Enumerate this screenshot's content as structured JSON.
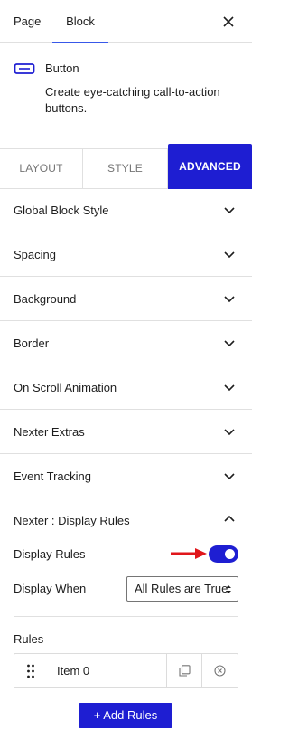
{
  "top_tabs": {
    "page": "Page",
    "block": "Block"
  },
  "block_card": {
    "name": "Button",
    "description": "Create eye-catching call-to-action buttons.",
    "icon": "button-icon"
  },
  "style_tabs": {
    "layout": "LAYOUT",
    "style": "STYLE",
    "advanced": "ADVANCED",
    "active": "ADVANCED"
  },
  "panels": [
    {
      "label": "Global Block Style"
    },
    {
      "label": "Spacing"
    },
    {
      "label": "Background"
    },
    {
      "label": "Border"
    },
    {
      "label": "On Scroll Animation"
    },
    {
      "label": "Nexter Extras"
    },
    {
      "label": "Event Tracking"
    }
  ],
  "display_rules_section": {
    "title": "Nexter : Display Rules",
    "display_rules_label": "Display Rules",
    "display_rules_enabled": true,
    "display_when_label": "Display When",
    "display_when_value": "All Rules are True",
    "rules_label": "Rules",
    "rules": [
      {
        "title": "Item 0"
      }
    ],
    "add_button": "+ Add Rules"
  },
  "colors": {
    "accent": "#1e1ed2",
    "tab_underline": "#3858e9",
    "arrow": "#e0161b"
  }
}
